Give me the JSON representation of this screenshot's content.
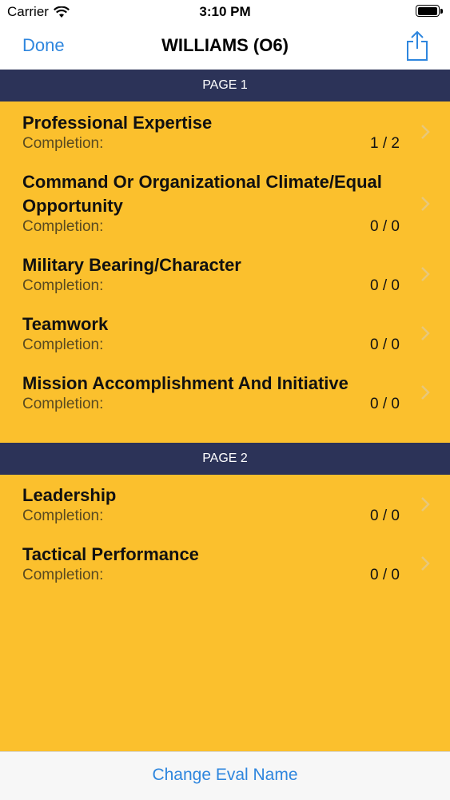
{
  "status_bar": {
    "carrier": "Carrier",
    "time": "3:10 PM"
  },
  "nav": {
    "done_label": "Done",
    "title": "WILLIAMS (O6)"
  },
  "sections": [
    {
      "header": "PAGE 1",
      "rows": [
        {
          "title": "Professional Expertise",
          "label": "Completion:",
          "value": "1 / 2"
        },
        {
          "title": "Command Or Organizational Climate/Equal Opportunity",
          "label": "Completion:",
          "value": "0 / 0"
        },
        {
          "title": "Military Bearing/Character",
          "label": "Completion:",
          "value": "0 / 0"
        },
        {
          "title": "Teamwork",
          "label": "Completion:",
          "value": "0 / 0"
        },
        {
          "title": "Mission Accomplishment And Initiative",
          "label": "Completion:",
          "value": "0 / 0"
        }
      ]
    },
    {
      "header": "PAGE 2",
      "rows": [
        {
          "title": "Leadership",
          "label": "Completion:",
          "value": "0 / 0"
        },
        {
          "title": "Tactical Performance",
          "label": "Completion:",
          "value": "0 / 0"
        }
      ]
    }
  ],
  "bottom": {
    "button_label": "Change Eval Name"
  },
  "colors": {
    "background": "#FBC02D",
    "section_header": "#2C3358",
    "accent": "#2E86DE"
  }
}
